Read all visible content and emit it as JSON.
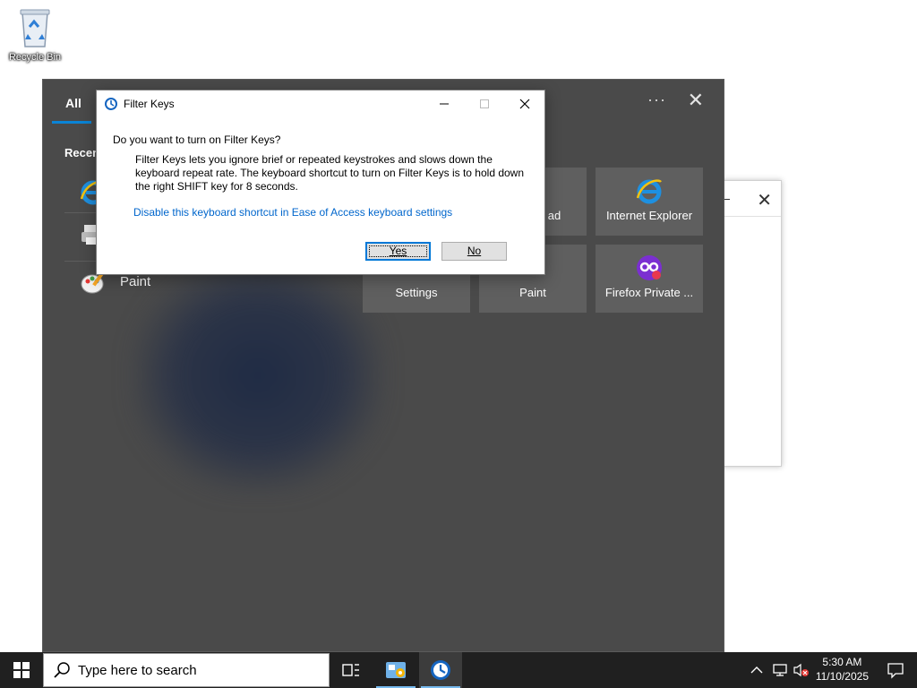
{
  "desktop": {
    "icons": [
      {
        "label": "Recycle Bin",
        "icon": "recycle-bin-icon"
      }
    ]
  },
  "search_panel": {
    "tab_all": "All",
    "more": "···",
    "recent_label": "Recent",
    "recent_items": [
      {
        "label": "",
        "icon": "internet-explorer-icon"
      },
      {
        "label": "",
        "icon": "printer-icon"
      },
      {
        "label": "Paint",
        "icon": "paint-icon"
      }
    ],
    "tiles": [
      {
        "label": "ad",
        "icon": "notepad-icon"
      },
      {
        "label": "Internet Explorer",
        "icon": "internet-explorer-icon"
      },
      {
        "label": "Settings",
        "icon": "settings-icon"
      },
      {
        "label": "Paint",
        "icon": "paint-icon"
      },
      {
        "label": "Firefox Private ...",
        "icon": "firefox-private-icon"
      }
    ]
  },
  "dialog": {
    "title": "Filter Keys",
    "question": "Do you want to turn on Filter Keys?",
    "body": "Filter Keys lets you ignore brief or repeated keystrokes and slows down the keyboard repeat rate.  The keyboard shortcut to turn on Filter Keys is to hold down the right SHIFT key for 8 seconds.",
    "link": "Disable this keyboard shortcut in Ease of Access keyboard settings",
    "yes": "Yes",
    "no": "No"
  },
  "taskbar": {
    "search_placeholder": "Type here to search",
    "time": "5:30 AM",
    "date": "11/10/2025"
  },
  "colors": {
    "panel_bg": "#4a4a4a",
    "tile_bg": "#5f5f5f",
    "taskbar_bg": "#202020",
    "accent": "#0078d7",
    "link": "#0066cc"
  }
}
